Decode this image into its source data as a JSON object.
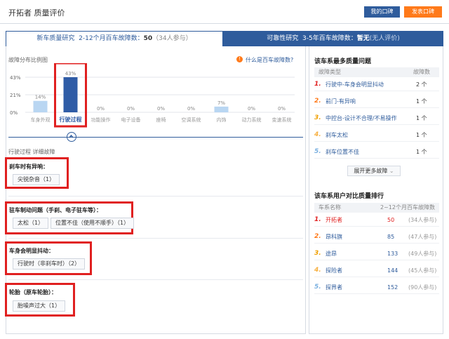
{
  "header": {
    "title": "开拓者  质量评价",
    "my_review": "我的口碑",
    "post_review": "发表口碑"
  },
  "tabs": [
    {
      "label": "新车质量研究",
      "desc": "2-12个月百车故障数：",
      "value": "50",
      "sub": "（34人参与）",
      "active": true
    },
    {
      "label": "可靠性研究",
      "desc": "3-5年百车故障数：",
      "value": "暂无",
      "sub": "(无人评价)",
      "active": false
    }
  ],
  "chart_header": {
    "label": "故障分布比例图",
    "help_icon": "info-icon",
    "help_text": "什么是百车故障数?"
  },
  "chart_data": {
    "type": "bar",
    "ylim": [
      0,
      43
    ],
    "yticks": [
      "43%",
      "21%",
      "0%"
    ],
    "categories": [
      "车身外观",
      "行驶过程",
      "功能操作",
      "电子设备",
      "座椅",
      "空调系统",
      "内饰",
      "动力系统",
      "变速系统"
    ],
    "values": [
      14,
      43,
      0,
      0,
      0,
      0,
      7,
      0,
      0
    ],
    "value_labels": [
      "14%",
      "43%",
      "0%",
      "0%",
      "0%",
      "0%",
      "7%",
      "0%",
      "0%"
    ],
    "selected_index": 1,
    "colors": {
      "normal": "#b9d6f2",
      "selected": "#2f5ca6"
    }
  },
  "breadcrumb": "行驶过程  详细故障",
  "fault_sections": [
    {
      "title": "刹车时有异响：",
      "tags": [
        "尖锐杂音（1）"
      ]
    },
    {
      "title": "驻车制动问题（手刹、电子驻车等）：",
      "tags": [
        "太松（1）",
        "位置不佳（使用不顺手）（1）"
      ]
    },
    {
      "title": "车身会明显抖动：",
      "tags": [
        "行驶时（非刹车时）（2）"
      ]
    },
    {
      "title": "轮胎（原车轮胎）：",
      "tags": [
        "胎噪声过大（1）"
      ]
    }
  ],
  "top_issues": {
    "title": "该车系最多质量问题",
    "col_type": "故障类型",
    "col_count": "故障数",
    "rows": [
      {
        "rank": "1.",
        "name": "行驶中-车身会明显抖动",
        "count": "2 个"
      },
      {
        "rank": "2.",
        "name": "前门-有异响",
        "count": "1 个"
      },
      {
        "rank": "3.",
        "name": "中控台-设计不合理/不易操作",
        "count": "1 个"
      },
      {
        "rank": "4.",
        "name": "刹车太松",
        "count": "1 个"
      },
      {
        "rank": "5.",
        "name": "刹车位置不佳",
        "count": "1 个"
      }
    ],
    "more": "展开更多故障"
  },
  "ranking": {
    "title": "该车系用户对比质量排行",
    "col_name": "车系名称",
    "col_val": "2~12个月百车故障数",
    "rows": [
      {
        "rank": "1.",
        "name": "开拓者",
        "value": "50",
        "count": "(34人参与)",
        "highlight": true
      },
      {
        "rank": "2.",
        "name": "昂科旗",
        "value": "85",
        "count": "(47人参与)",
        "highlight": false
      },
      {
        "rank": "3.",
        "name": "途昂",
        "value": "133",
        "count": "(49人参与)",
        "highlight": false
      },
      {
        "rank": "4.",
        "name": "探险者",
        "value": "144",
        "count": "(45人参与)",
        "highlight": false
      },
      {
        "rank": "5.",
        "name": "探界者",
        "value": "152",
        "count": "(90人参与)",
        "highlight": false
      }
    ]
  },
  "colors": {
    "brand": "#2f5c9c",
    "accent": "#ff7a1a",
    "highlight": "#e02020",
    "rank1": "#e02020",
    "rank2": "#ff7a1a",
    "rank3": "#f0a000",
    "rank4": "#f7b040",
    "rank5": "#7ab0e0"
  }
}
